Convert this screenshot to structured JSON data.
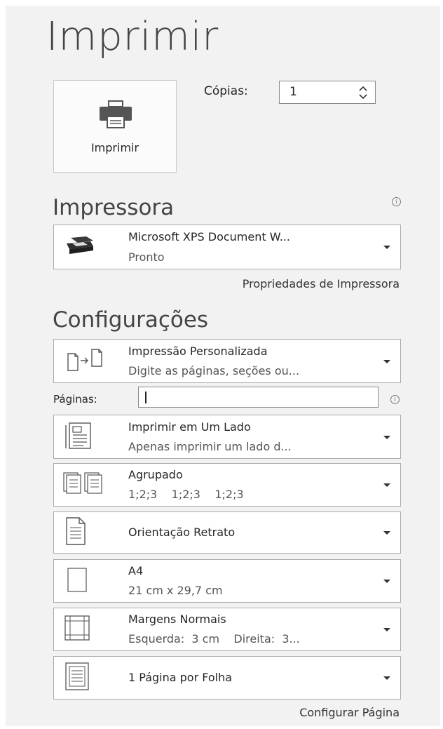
{
  "title": "Imprimir",
  "print_button": {
    "label": "Imprimir",
    "icon": "printer-icon"
  },
  "copies": {
    "label": "Cópias:",
    "value": "1"
  },
  "printer_section": {
    "heading": "Impressora",
    "name": "Microsoft XPS Document W...",
    "status": "Pronto",
    "properties_link": "Propriedades de Impressora"
  },
  "settings_section": {
    "heading": "Configurações",
    "pages_label": "Páginas:",
    "pages_value": "",
    "page_setup_link": "Configurar Página",
    "items": [
      {
        "title": "Impressão Personalizada",
        "subtitle": "Digite as páginas, seções ou...",
        "icon": "custom-print-icon"
      },
      {
        "title": "Imprimir em Um Lado",
        "subtitle": "Apenas imprimir um lado d...",
        "icon": "one-side-icon"
      },
      {
        "title": "Agrupado",
        "subtitle": "1;2;3    1;2;3    1;2;3",
        "icon": "collated-icon"
      },
      {
        "title": "Orientação Retrato",
        "subtitle": "",
        "icon": "portrait-icon"
      },
      {
        "title": "A4",
        "subtitle": "21 cm x 29,7 cm",
        "icon": "paper-size-icon"
      },
      {
        "title": "Margens Normais",
        "subtitle": "Esquerda:  3 cm    Direita:  3...",
        "icon": "margins-icon"
      },
      {
        "title": "1 Página por Folha",
        "subtitle": "",
        "icon": "pages-per-sheet-icon"
      }
    ]
  }
}
